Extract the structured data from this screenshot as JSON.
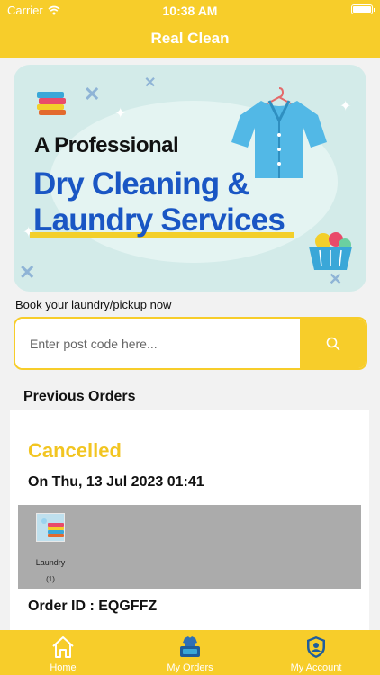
{
  "status_bar": {
    "carrier": "Carrier",
    "time": "10:38 AM"
  },
  "header": {
    "title": "Real Clean"
  },
  "banner": {
    "line1": "A Professional",
    "line2": "Dry Cleaning &",
    "line3": "Laundry Services"
  },
  "booking": {
    "label": "Book your laundry/pickup now",
    "placeholder": "Enter post code here..."
  },
  "orders": {
    "section_title": "Previous Orders",
    "items": [
      {
        "status": "Cancelled",
        "date": "On Thu, 13 Jul 2023 01:41",
        "item_name": "Laundry",
        "item_qty": "(1)",
        "order_id": "Order ID : EQGFFZ"
      }
    ]
  },
  "tabbar": {
    "home": "Home",
    "orders": "My Orders",
    "account": "My Account"
  },
  "colors": {
    "brand_yellow": "#f7cd2a",
    "status_cancelled": "#f2c521",
    "banner_blue": "#1a56c4"
  },
  "icons": {
    "search": "search-icon",
    "home": "home-icon",
    "orders": "laundry-basket-icon",
    "account": "shield-user-icon"
  }
}
